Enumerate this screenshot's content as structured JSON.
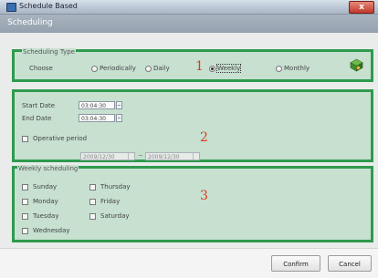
{
  "window": {
    "title": "Schedule Based",
    "close_label": "x"
  },
  "header": {
    "title": "Scheduling"
  },
  "section1": {
    "legend": "Scheduling Type",
    "choose_label": "Choose",
    "options": [
      "Periodically",
      "Daily",
      "Weekly",
      "Monthly"
    ],
    "selected": "Weekly",
    "marker": "1",
    "icon": "scheduling-cube-icon"
  },
  "section2": {
    "start_label": "Start Date",
    "start_value": "03:04:30",
    "end_label": "End Date",
    "end_value": "03:04:30",
    "operative_label": "Operative period",
    "from_date": "2009/12/30",
    "separator": "~",
    "to_date": "2009/12/30",
    "marker": "2"
  },
  "section3": {
    "legend": "Weekly scheduling",
    "days_col1": [
      "Sunday",
      "Monday",
      "Tuesday",
      "Wednesday"
    ],
    "days_col2": [
      "Thursday",
      "Friday",
      "Saturday"
    ],
    "marker": "3"
  },
  "footer": {
    "confirm_label": "Confirm",
    "cancel_label": "Cancel"
  },
  "colors": {
    "panel_border": "#2f9a4e",
    "panel_bg": "#c7e0d0",
    "marker": "#d93a1e"
  }
}
